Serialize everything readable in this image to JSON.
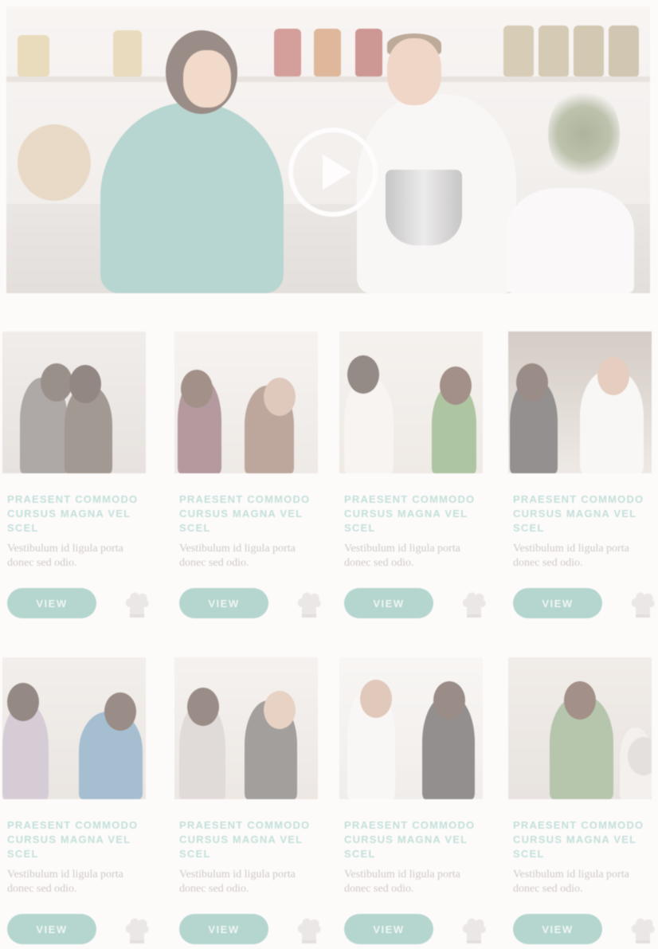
{
  "hero": {
    "play_icon": "play-circle-icon",
    "colors": {
      "play": "#ffffff"
    }
  },
  "cards": [
    {
      "title": "PRAESENT COMMODO CURSUS MAGNA VEL SCEL",
      "description": "Vestibulum id ligula porta donec sed odio.",
      "button_label": "VIEW",
      "icon": "chef-hat-icon"
    },
    {
      "title": "PRAESENT COMMODO CURSUS MAGNA VEL SCEL",
      "description": "Vestibulum id ligula porta donec sed odio.",
      "button_label": "VIEW",
      "icon": "chef-hat-icon"
    },
    {
      "title": "PRAESENT COMMODO CURSUS MAGNA VEL SCEL",
      "description": "Vestibulum id ligula porta donec sed odio.",
      "button_label": "VIEW",
      "icon": "chef-hat-icon"
    },
    {
      "title": "PRAESENT COMMODO CURSUS MAGNA VEL SCEL",
      "description": "Vestibulum id ligula porta donec sed odio.",
      "button_label": "VIEW",
      "icon": "chef-hat-icon"
    },
    {
      "title": "PRAESENT COMMODO CURSUS MAGNA VEL SCEL",
      "description": "Vestibulum id ligula porta donec sed odio.",
      "button_label": "VIEW",
      "icon": "chef-hat-icon"
    },
    {
      "title": "PRAESENT COMMODO CURSUS MAGNA VEL SCEL",
      "description": "Vestibulum id ligula porta donec sed odio.",
      "button_label": "VIEW",
      "icon": "chef-hat-icon"
    },
    {
      "title": "PRAESENT COMMODO CURSUS MAGNA VEL SCEL",
      "description": "Vestibulum id ligula porta donec sed odio.",
      "button_label": "VIEW",
      "icon": "chef-hat-icon"
    },
    {
      "title": "PRAESENT COMMODO CURSUS MAGNA VEL SCEL",
      "description": "Vestibulum id ligula porta donec sed odio.",
      "button_label": "VIEW",
      "icon": "chef-hat-icon"
    }
  ],
  "colors": {
    "accent": "#79b9ac",
    "title_text": "#93cbbf",
    "body_text": "#a9a29d"
  }
}
